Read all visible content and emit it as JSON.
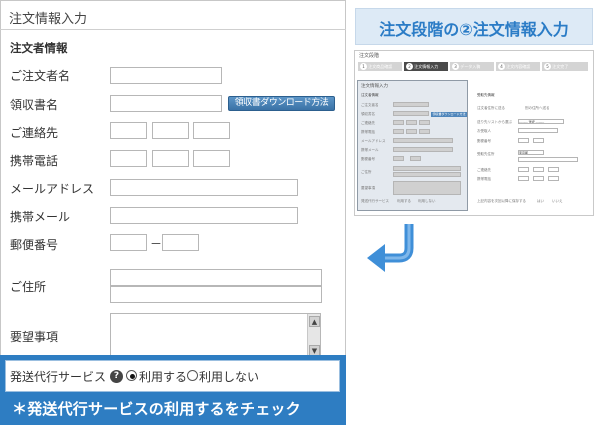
{
  "form": {
    "title": "注文情報入力",
    "section_heading": "注文者情報",
    "fields": {
      "orderer_name": "ご注文者名",
      "receipt_name": "領収書名",
      "contact": "ご連絡先",
      "mobile": "携帯電話",
      "email": "メールアドレス",
      "mobile_mail": "携帯メール",
      "postal_code": "郵便番号",
      "address": "ご住所",
      "request": "要望事項"
    },
    "receipt_download_button": "領収書ダウンロード方法",
    "postal_dash": "－",
    "scroll_up": "▲",
    "scroll_down": "▼",
    "shipping_service": {
      "label": "発送代行サービス",
      "help_icon": "?",
      "option_use": "利用する",
      "option_not_use": "利用しない",
      "selected": "利用する"
    }
  },
  "annotation": "＊発送代行サービスの利用するをチェック",
  "step_title": "注文段階の②注文情報入力",
  "mini_screenshot": {
    "page_title": "注文段階",
    "steps": [
      {
        "num": "1",
        "label": "注文商品確認",
        "active": false
      },
      {
        "num": "2",
        "label": "注文情報入力",
        "active": true
      },
      {
        "num": "3",
        "label": "データ入稿",
        "active": false
      },
      {
        "num": "4",
        "label": "注文内容確認",
        "active": false
      },
      {
        "num": "5",
        "label": "注文完了",
        "active": false
      }
    ],
    "left_title": "注文情報入力",
    "left_section": "注文者情報",
    "left_rows": [
      "ご注文者名",
      "領収書名",
      "ご連絡先",
      "携帯電話",
      "メールアドレス",
      "携帯メール",
      "郵便番号",
      "ご住所",
      "要望事項"
    ],
    "left_dl_button": "領収書ダウンロード方法",
    "left_shipping": "発送代行サービス",
    "left_shipping_options": [
      "利用する",
      "利用しない"
    ],
    "right_section": "受取先情報",
    "right_radio": [
      "注文者住所に送る",
      "別の住所へ送る"
    ],
    "right_rows": [
      "送り先リストから選ぶ",
      "お受取人",
      "郵便番号",
      "受取先住所",
      "ご連絡先",
      "携帯電話"
    ],
    "right_select_value": "-------- 選択 --------",
    "right_pref_value": "東京都",
    "right_bottom_note": "上記内容を次回以降に保存する",
    "right_bottom_options": [
      "はい",
      "いいえ"
    ]
  },
  "colors": {
    "accent_blue": "#2e7dc2",
    "banner_bg": "#ddeaf6",
    "banner_text": "#2b7cc6",
    "arrow": "#3f8fd8"
  },
  "icons": {
    "help": "question-circle-icon",
    "arrow": "return-arrow-icon"
  }
}
